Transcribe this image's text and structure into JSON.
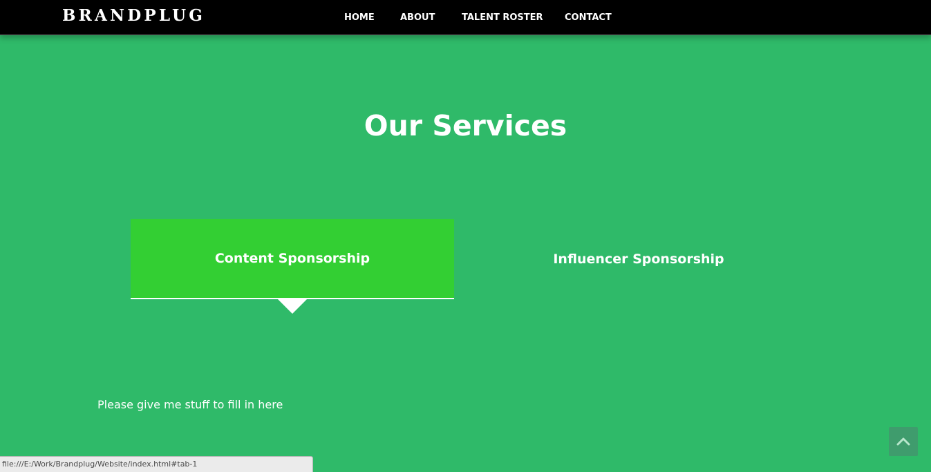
{
  "navbar": {
    "brand": "BRANDPLUG",
    "links": [
      {
        "label": "HOME"
      },
      {
        "label": "ABOUT"
      },
      {
        "label": "TALENT ROSTER"
      },
      {
        "label": "CONTACT"
      }
    ]
  },
  "services": {
    "title": "Our Services",
    "tabs": [
      {
        "label": "Content Sponsorship",
        "active": true
      },
      {
        "label": "Influencer Sponsorship",
        "active": false
      }
    ],
    "content": "Please give me stuff to fill in here"
  },
  "scroll_top": {
    "icon": "chevron-up-icon"
  },
  "status_bar": {
    "url": "file:///E:/Work/Brandplug/Website/index.html#tab-1"
  },
  "colors": {
    "background": "#2fba69",
    "navbar": "#000000",
    "active_tab": "#33cf33",
    "scroll_button": "#3f9c6d",
    "text": "#ffffff"
  }
}
